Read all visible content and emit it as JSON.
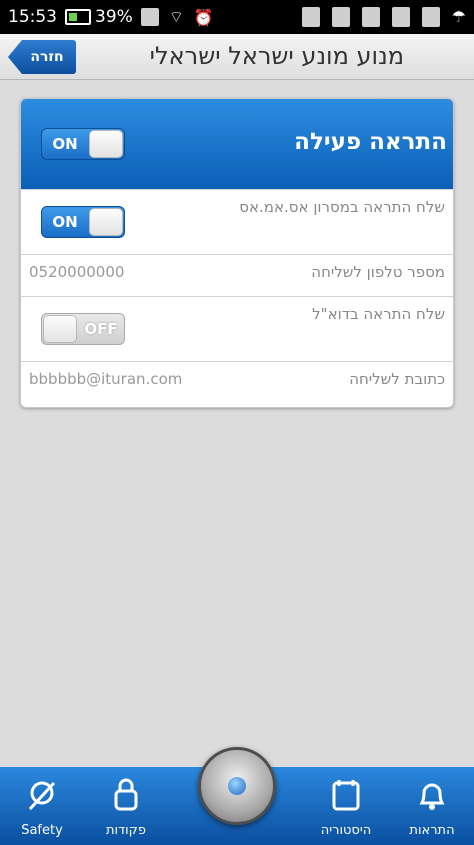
{
  "status_bar": {
    "time": "15:53",
    "battery": "39%"
  },
  "header": {
    "title": "מנוע מונע ישראל ישראלי",
    "back_label": "חזרה"
  },
  "card": {
    "title": "התראה פעילה",
    "main_toggle": "ON",
    "rows": [
      {
        "label": "שלח התראה במסרון אס.אמ.אס",
        "toggle": "ON"
      },
      {
        "label": "מספר טלפון לשליחה",
        "value": "0520000000"
      },
      {
        "label": "שלח התראה בדוא\"ל",
        "toggle": "OFF"
      },
      {
        "label": "כתובת לשליחה",
        "value": "bbbbbb@ituran.com"
      }
    ]
  },
  "bottom_nav": {
    "items": [
      {
        "label": "Safety",
        "icon": "safety-icon"
      },
      {
        "label": "פקודות",
        "icon": "lock-icon"
      },
      {
        "label": "היסטוריה",
        "icon": "history-icon"
      },
      {
        "label": "התראות",
        "icon": "bell-icon"
      }
    ]
  },
  "colors": {
    "accent": "#1a6ec7",
    "header_bg": "#e8e8e8",
    "page_bg": "#dcdcdc"
  }
}
